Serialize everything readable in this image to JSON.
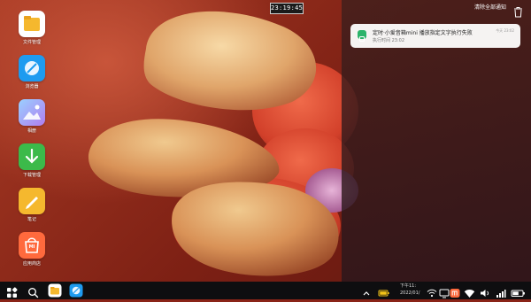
{
  "clock": {
    "time": "23:19:45"
  },
  "desktop_icons": [
    {
      "label": "文件管理",
      "icon": "folder-icon",
      "color": "#f5b82e"
    },
    {
      "label": "浏览器",
      "icon": "browser-icon",
      "color": "#1e9bf0"
    },
    {
      "label": "相册",
      "icon": "gallery-icon",
      "color": "#6a8cf0"
    },
    {
      "label": "下载管理",
      "icon": "download-icon",
      "color": "#3cba4a"
    },
    {
      "label": "笔记",
      "icon": "notes-icon",
      "color": "#f5b82e"
    },
    {
      "label": "应用商店",
      "icon": "app-store-icon",
      "color": "#ff6a3d",
      "glyph": "MI"
    }
  ],
  "notifications": {
    "clear_all_label": "清除全部通知",
    "items": [
      {
        "title": "定时·小爱音箱mini 播放指定文字执行失败",
        "subtitle": "执行时间 23:02",
        "when": "今天 23:02",
        "icon": "xiaoai-app-icon"
      }
    ]
  },
  "taskbar": {
    "apps": [
      "start-icon",
      "search-icon",
      "file-manager-icon",
      "browser-icon"
    ],
    "tray": {
      "clock_line1": "下午11:",
      "clock_line2": "2022/01/"
    }
  },
  "colors": {
    "panel_bg": "#3c1e1c",
    "card_bg": "#f5f3f2",
    "notif_icon": "#2bb36a",
    "taskbar_bg": "#0e0e10"
  }
}
